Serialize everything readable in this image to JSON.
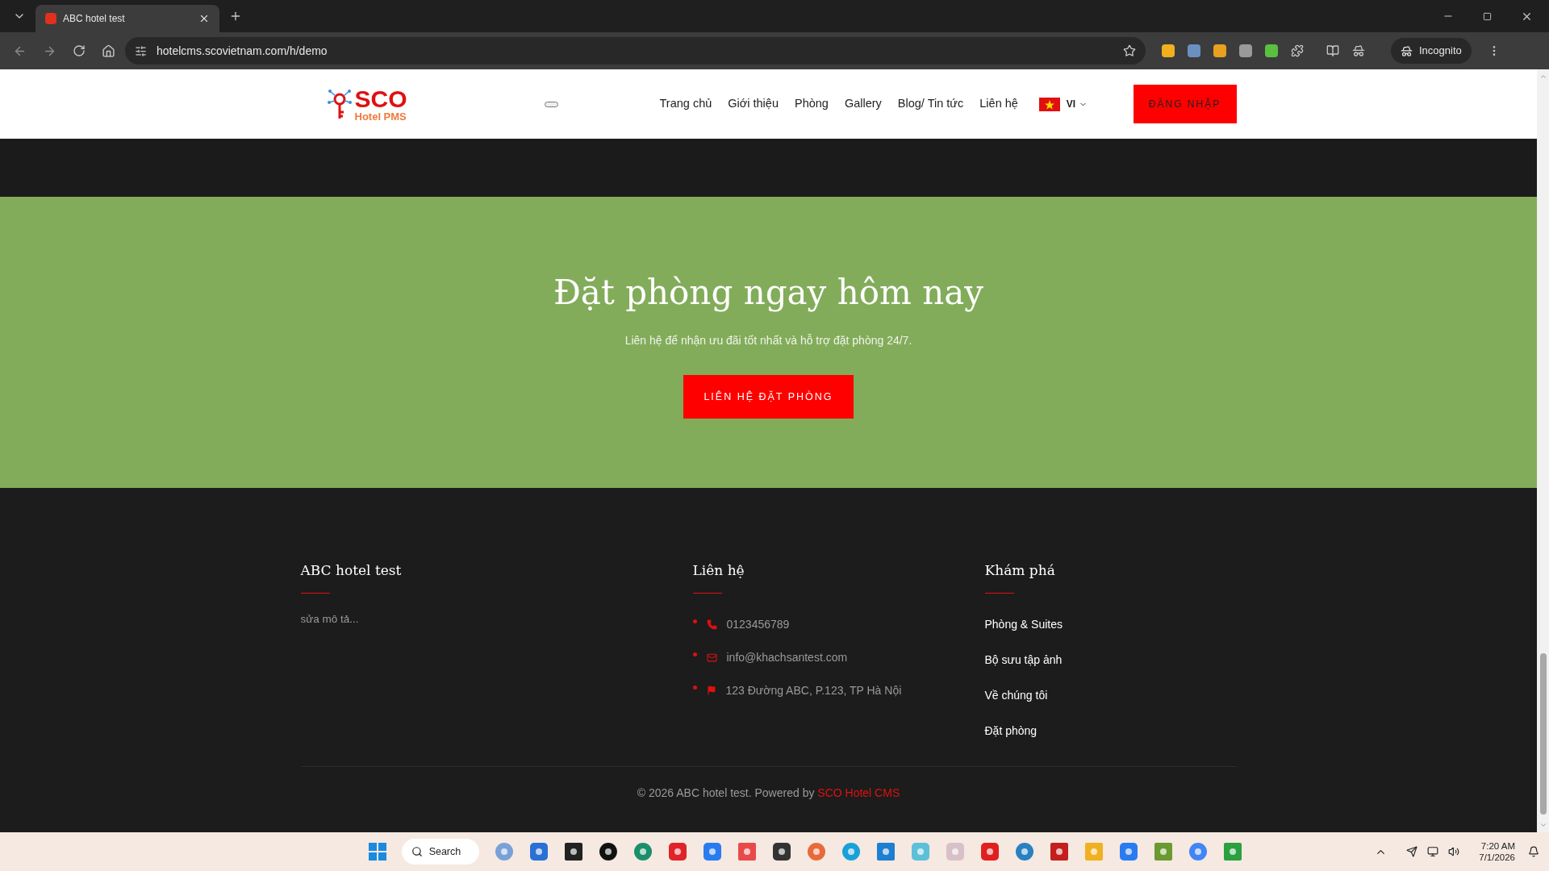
{
  "browser": {
    "tab_title": "ABC hotel test",
    "address": "hotelcms.scovietnam.com/h/demo",
    "profile": "Incognito"
  },
  "header": {
    "logo": {
      "name": "SCO",
      "sub": "Hotel PMS"
    },
    "nav": [
      "Trang chủ",
      "Giới thiệu",
      "Phòng",
      "Gallery",
      "Blog/ Tin tức",
      "Liên hệ"
    ],
    "language": "VI",
    "login": "ĐĂNG NHẬP"
  },
  "hero": {
    "title": "Đặt phòng ngay hôm nay",
    "subtitle": "Liên hệ để nhận ưu đãi tốt nhất và hỗ trợ đặt phòng 24/7.",
    "button": "LIÊN HỆ ĐẶT PHÒNG"
  },
  "footer": {
    "about": {
      "title": "ABC hotel test",
      "text": "sửa mô tả..."
    },
    "contact": {
      "title": "Liên hệ",
      "items": [
        {
          "kind": "phone",
          "text": "0123456789"
        },
        {
          "kind": "email",
          "text": "info@khachsantest.com"
        },
        {
          "kind": "address",
          "text": "123 Đường ABC, P.123, TP Hà Nội"
        }
      ]
    },
    "explore": {
      "title": "Khám phá",
      "links": [
        "Phòng & Suites",
        "Bộ sưu tập ảnh",
        "Về chúng tôi",
        "Đặt phòng"
      ]
    },
    "copyright": {
      "text": "© 2026 ABC hotel test. Powered by",
      "link": "SCO Hotel CMS"
    }
  },
  "taskbar": {
    "search": "Search",
    "time": "7:20 AM",
    "date": "7/1/2026"
  }
}
